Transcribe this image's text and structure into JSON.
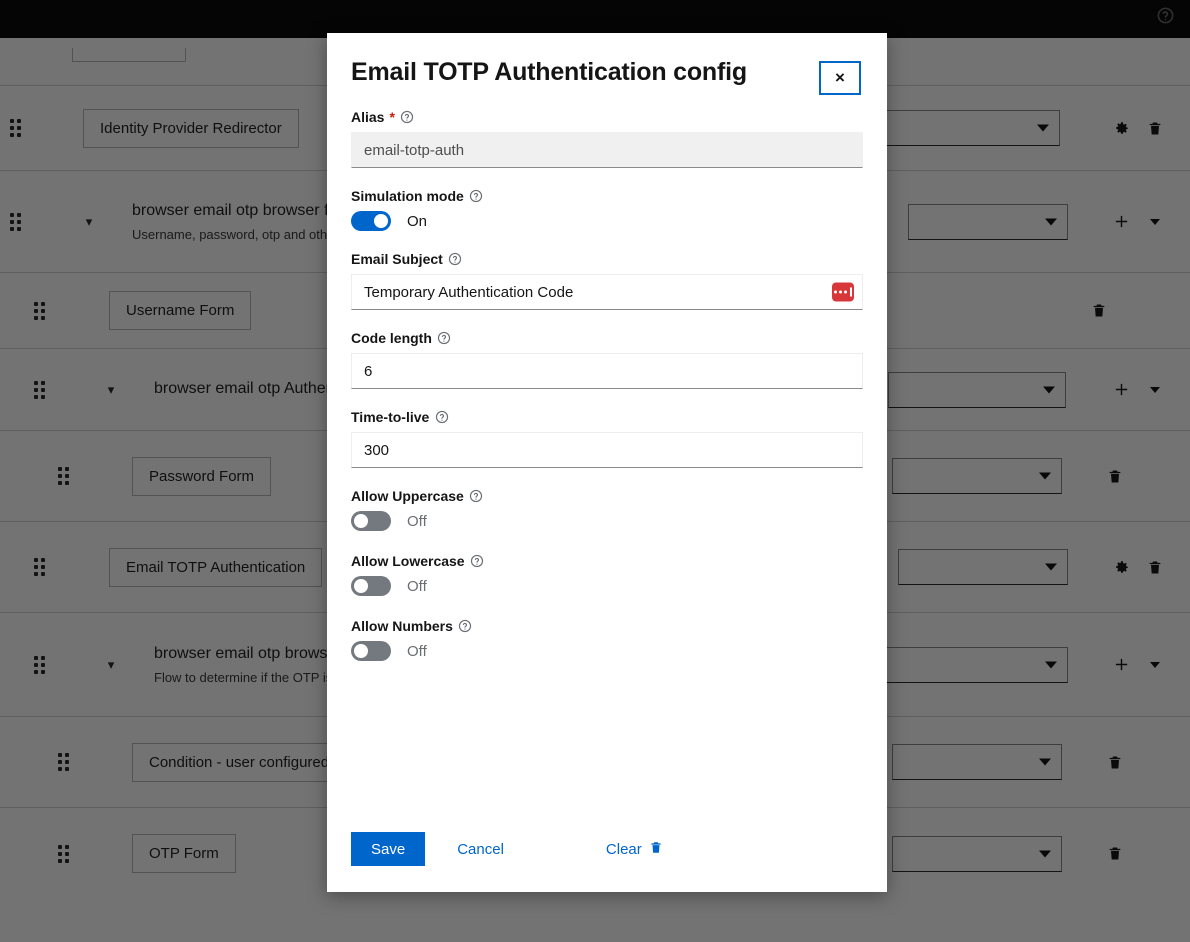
{
  "background": {
    "topbar": {
      "help_icon": "help-circle-icon"
    },
    "rows": [
      {
        "kind": "partial",
        "grip": true,
        "pill": "",
        "has_select": false,
        "actions": []
      },
      {
        "kind": "step",
        "grip": true,
        "pill": "Identity Provider Redirector",
        "has_select": true,
        "actions": [
          "gear-icon",
          "trash-icon"
        ]
      },
      {
        "kind": "flow",
        "grip": true,
        "chevron": "chevron-down-icon",
        "title": "browser email otp browser forms",
        "desc": "Username, password, otp and other auth forms.",
        "has_select": true,
        "actions": [
          "plus-icon",
          "caret-down-icon"
        ]
      },
      {
        "kind": "step",
        "grip": true,
        "pill": "Username Form",
        "has_select": false,
        "actions": [
          "trash-icon"
        ]
      },
      {
        "kind": "flow",
        "grip": true,
        "chevron": "chevron-down-icon",
        "title": "browser email otp Authentication",
        "desc": "",
        "has_select": true,
        "actions": [
          "plus-icon",
          "caret-down-icon"
        ]
      },
      {
        "kind": "step",
        "grip": true,
        "pill": "Password Form",
        "has_select": true,
        "actions": [
          "trash-icon"
        ]
      },
      {
        "kind": "step",
        "grip": true,
        "pill": "Email TOTP Authentication",
        "has_select": true,
        "actions": [
          "gear-icon",
          "trash-icon"
        ]
      },
      {
        "kind": "flow",
        "grip": true,
        "chevron": "chevron-down-icon",
        "title": "browser email otp browser forms Conditional OTP",
        "desc": "Flow to determine if the OTP is required for the authentication",
        "has_select": true,
        "actions": [
          "plus-icon",
          "caret-down-icon"
        ]
      },
      {
        "kind": "step",
        "grip": true,
        "pill": "Condition - user configured",
        "has_select": true,
        "actions": [
          "trash-icon"
        ]
      },
      {
        "kind": "step",
        "grip": true,
        "pill": "OTP Form",
        "has_select": true,
        "actions": [
          "trash-icon"
        ]
      }
    ]
  },
  "modal": {
    "title": "Email TOTP Authentication config",
    "close_label": "×",
    "fields": {
      "alias": {
        "label": "Alias",
        "required_mark": "*",
        "help_icon": "help-circle-icon",
        "value": "email-totp-auth",
        "placeholder": ""
      },
      "simulation_mode": {
        "label": "Simulation mode",
        "help_icon": "help-circle-icon",
        "state": "On",
        "on": true
      },
      "email_subject": {
        "label": "Email Subject",
        "help_icon": "help-circle-icon",
        "value": "Temporary Authentication Code",
        "placeholder": "",
        "badge_icon": "password-manager-icon"
      },
      "code_length": {
        "label": "Code length",
        "help_icon": "help-circle-icon",
        "value": "6",
        "placeholder": ""
      },
      "time_to_live": {
        "label": "Time-to-live",
        "help_icon": "help-circle-icon",
        "value": "300",
        "placeholder": ""
      },
      "allow_uppercase": {
        "label": "Allow Uppercase",
        "help_icon": "help-circle-icon",
        "state": "Off",
        "on": false
      },
      "allow_lowercase": {
        "label": "Allow Lowercase",
        "help_icon": "help-circle-icon",
        "state": "Off",
        "on": false
      },
      "allow_numbers": {
        "label": "Allow Numbers",
        "help_icon": "help-circle-icon",
        "state": "Off",
        "on": false
      }
    },
    "footer": {
      "save_label": "Save",
      "cancel_label": "Cancel",
      "clear_label": "Clear",
      "clear_icon": "trash-icon"
    }
  },
  "colors": {
    "accent": "#0066cc",
    "toggle_on": "#0066cc",
    "toggle_off": "#73797f",
    "required": "#c9190b",
    "badge_red": "#d8373a",
    "topbar": "#0d0d0d"
  }
}
